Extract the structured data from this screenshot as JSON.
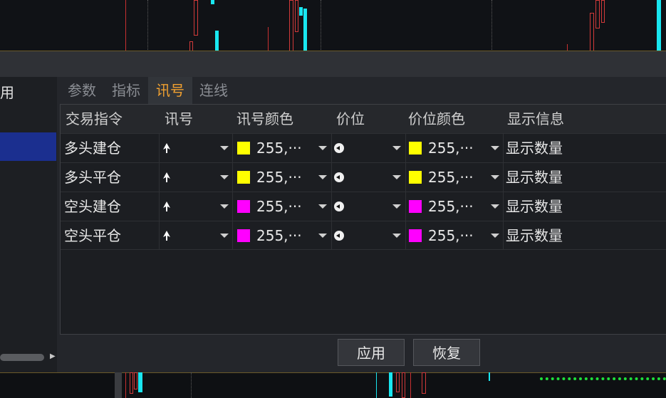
{
  "left_panel": {
    "header_label": "用"
  },
  "tabs": [
    {
      "label": "参数",
      "active": false
    },
    {
      "label": "指标",
      "active": false
    },
    {
      "label": "讯号",
      "active": true
    },
    {
      "label": "连线",
      "active": false
    }
  ],
  "table": {
    "columns": [
      "交易指令",
      "讯号",
      "讯号颜色",
      "价位",
      "价位颜色",
      "显示信息"
    ],
    "rows": [
      {
        "instruction": "多头建仓",
        "signal_icon": "arrow-up-icon",
        "signal_color_value": "255,···",
        "signal_color": "#ffff00",
        "price_icon": "circle-arrow-left-icon",
        "price_color_value": "255,···",
        "price_color": "#ffff00",
        "display": "显示数量"
      },
      {
        "instruction": "多头平仓",
        "signal_icon": "arrow-up-icon",
        "signal_color_value": "255,···",
        "signal_color": "#ffff00",
        "price_icon": "circle-arrow-left-icon",
        "price_color_value": "255,···",
        "price_color": "#ffff00",
        "display": "显示数量"
      },
      {
        "instruction": "空头建仓",
        "signal_icon": "arrow-up-icon",
        "signal_color_value": "255,···",
        "signal_color": "#ff00ff",
        "price_icon": "circle-arrow-left-icon",
        "price_color_value": "255,···",
        "price_color": "#ff00ff",
        "display": "显示数量"
      },
      {
        "instruction": "空头平仓",
        "signal_icon": "arrow-up-icon",
        "signal_color_value": "255,···",
        "signal_color": "#ff00ff",
        "price_icon": "circle-arrow-left-icon",
        "price_color_value": "255,···",
        "price_color": "#ff00ff",
        "display": "显示数量"
      }
    ]
  },
  "buttons": {
    "apply": "应用",
    "restore": "恢复"
  },
  "colors": {
    "active_tab": "#f0a030",
    "selected_row": "#1b2f8f",
    "cyan_candle": "#19e6f0",
    "red_candle": "#d23a3a",
    "green_dots": "#1ee03a"
  }
}
